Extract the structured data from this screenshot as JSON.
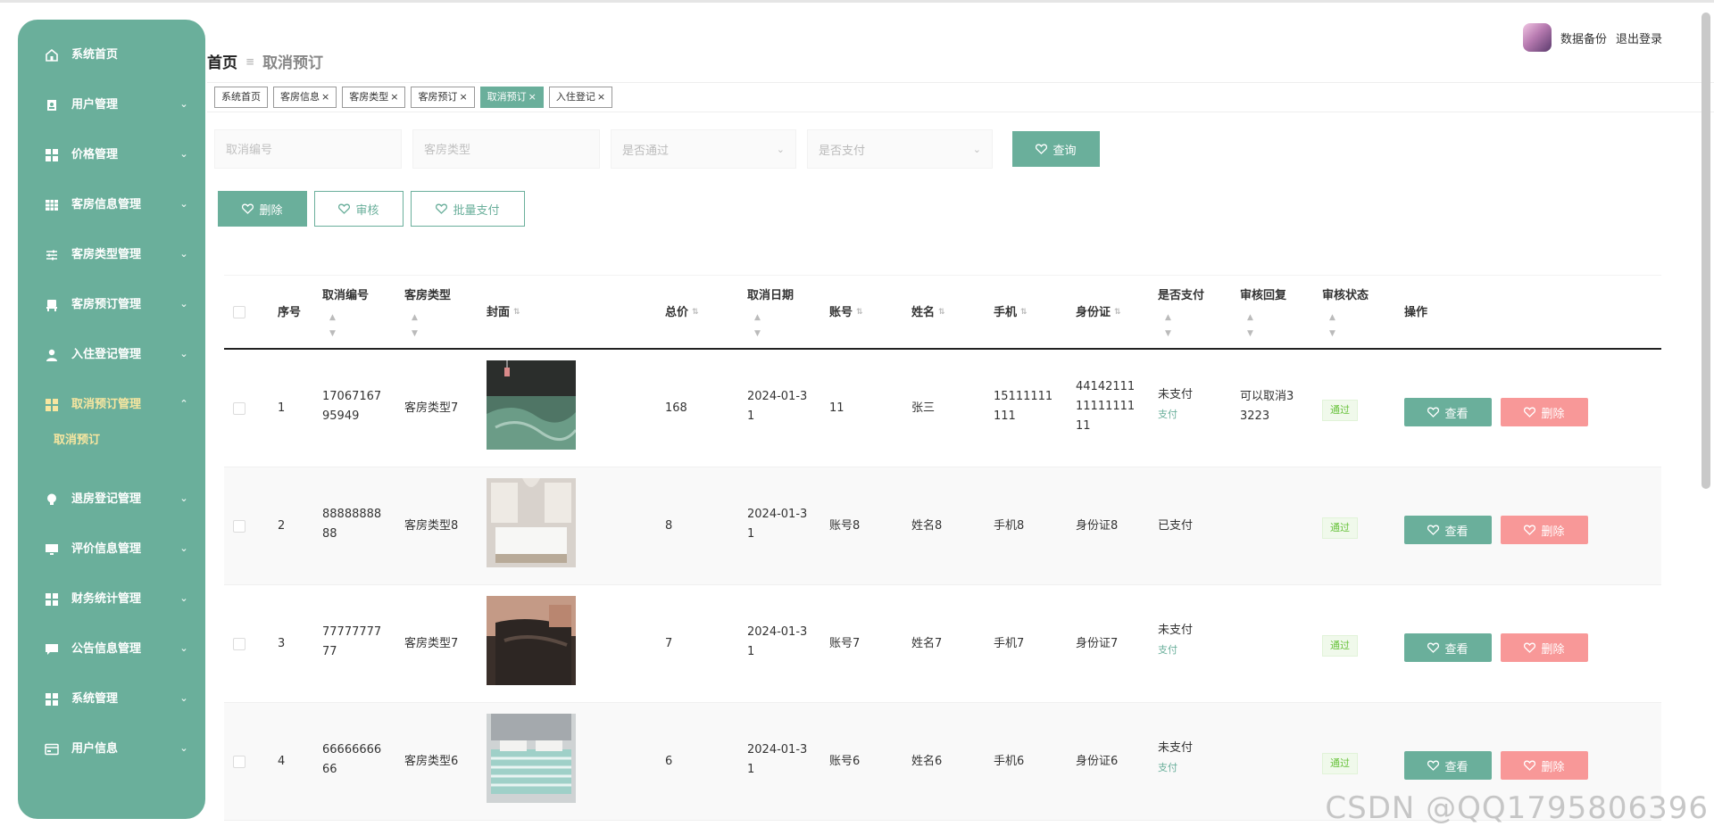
{
  "sidebar": {
    "items": [
      {
        "label": "系统首页",
        "icon": "home-icon"
      },
      {
        "label": "用户管理",
        "icon": "user-doc-icon"
      },
      {
        "label": "价格管理",
        "icon": "grid-icon"
      },
      {
        "label": "客房信息管理",
        "icon": "table-icon"
      },
      {
        "label": "客房类型管理",
        "icon": "sliders-icon"
      },
      {
        "label": "客房预订管理",
        "icon": "chair-icon"
      },
      {
        "label": "入住登记管理",
        "icon": "person-icon"
      },
      {
        "label": "取消预订管理",
        "icon": "grid-icon"
      },
      {
        "label": "退房登记管理",
        "icon": "bulb-icon"
      },
      {
        "label": "评价信息管理",
        "icon": "monitor-icon"
      },
      {
        "label": "财务统计管理",
        "icon": "grid-icon"
      },
      {
        "label": "公告信息管理",
        "icon": "chat-icon"
      },
      {
        "label": "系统管理",
        "icon": "grid-icon"
      },
      {
        "label": "用户信息",
        "icon": "card-icon"
      }
    ],
    "active_sub": "取消预订"
  },
  "header": {
    "breadcrumb_home": "首页",
    "breadcrumb_sep": "≡",
    "breadcrumb_current": "取消预订",
    "backup": "数据备份",
    "logout": "退出登录"
  },
  "tabs": [
    {
      "label": "系统首页",
      "closable": false
    },
    {
      "label": "客房信息",
      "closable": true
    },
    {
      "label": "客房类型",
      "closable": true
    },
    {
      "label": "客房预订",
      "closable": true
    },
    {
      "label": "取消预订",
      "closable": true,
      "active": true
    },
    {
      "label": "入住登记",
      "closable": true
    }
  ],
  "close_glyph": "×",
  "search": {
    "cancel_no_placeholder": "取消编号",
    "room_type_placeholder": "客房类型",
    "passed_select": "是否通过",
    "paid_select": "是否支付",
    "query_label": "查询"
  },
  "actions": {
    "delete": "删除",
    "audit": "审核",
    "batch_pay": "批量支付"
  },
  "table": {
    "headers": {
      "index": "序号",
      "cancel_no": "取消编号",
      "room_type": "客房类型",
      "cover": "封面",
      "total": "总价",
      "cancel_date": "取消日期",
      "account": "账号",
      "name": "姓名",
      "phone": "手机",
      "id_card": "身份证",
      "paid": "是否支付",
      "audit_reply": "审核回复",
      "audit_status": "审核状态",
      "operation": "操作"
    },
    "rows": [
      {
        "index": "1",
        "cancel_no_1": "17067167",
        "cancel_no_2": "95949",
        "room_type": "客房类型7",
        "total": "168",
        "date_1": "2024-01-3",
        "date_2": "1",
        "account": "11",
        "name": "张三",
        "phone_1": "15111111",
        "phone_2": "111",
        "id_1": "44142111",
        "id_2": "11111111",
        "id_3": "11",
        "paid": "未支付",
        "pay_link": "支付",
        "reply_1": "可以取消3",
        "reply_2": "3223",
        "status": "通过"
      },
      {
        "index": "2",
        "cancel_no_1": "88888888",
        "cancel_no_2": "88",
        "room_type": "客房类型8",
        "total": "8",
        "date_1": "2024-01-3",
        "date_2": "1",
        "account": "账号8",
        "name": "姓名8",
        "phone_1": "手机8",
        "phone_2": "",
        "id_1": "身份证8",
        "id_2": "",
        "id_3": "",
        "paid": "已支付",
        "pay_link": "",
        "reply_1": "",
        "reply_2": "",
        "status": "通过"
      },
      {
        "index": "3",
        "cancel_no_1": "77777777",
        "cancel_no_2": "77",
        "room_type": "客房类型7",
        "total": "7",
        "date_1": "2024-01-3",
        "date_2": "1",
        "account": "账号7",
        "name": "姓名7",
        "phone_1": "手机7",
        "phone_2": "",
        "id_1": "身份证7",
        "id_2": "",
        "id_3": "",
        "paid": "未支付",
        "pay_link": "支付",
        "reply_1": "",
        "reply_2": "",
        "status": "通过"
      },
      {
        "index": "4",
        "cancel_no_1": "66666666",
        "cancel_no_2": "66",
        "room_type": "客房类型6",
        "total": "6",
        "date_1": "2024-01-3",
        "date_2": "1",
        "account": "账号6",
        "name": "姓名6",
        "phone_1": "手机6",
        "phone_2": "",
        "id_1": "身份证6",
        "id_2": "",
        "id_3": "",
        "paid": "未支付",
        "pay_link": "支付",
        "reply_1": "",
        "reply_2": "",
        "status": "通过"
      }
    ],
    "view_label": "查看",
    "delete_label": "删除"
  },
  "watermark": "CSDN @QQ1795806396",
  "colors": {
    "primary": "#6aaf9b",
    "danger": "#f89898",
    "success": "#67c23a",
    "active_menu_text": "#f7e6a0"
  }
}
